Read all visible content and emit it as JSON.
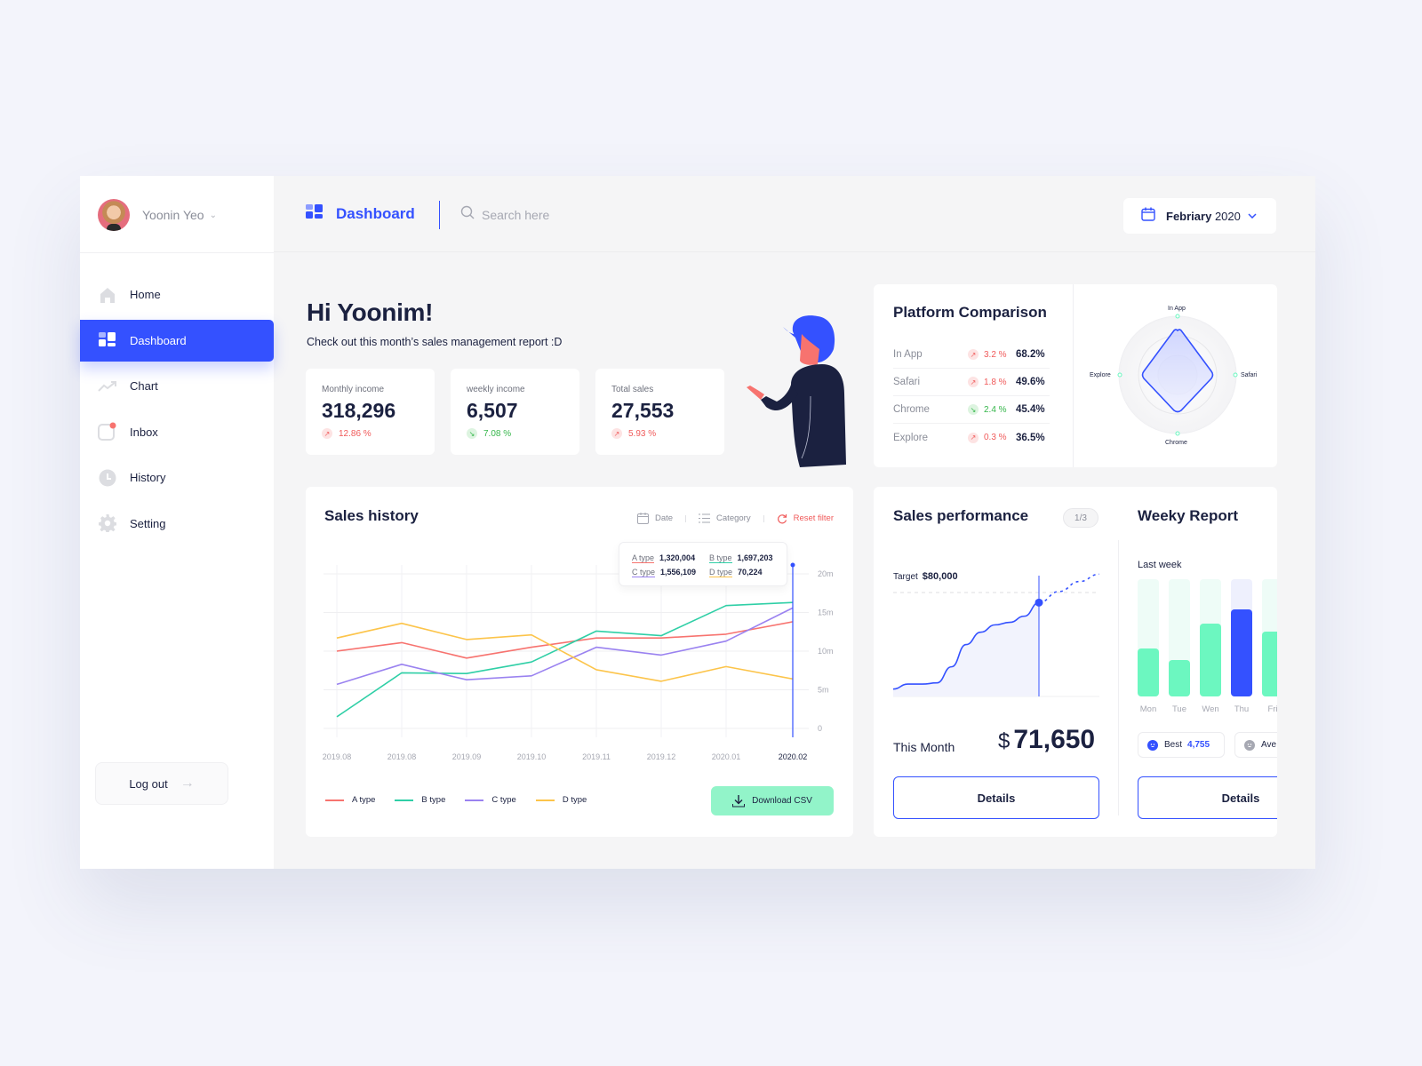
{
  "user": {
    "name": "Yoonin Yeo"
  },
  "sidebar": {
    "items": [
      {
        "label": "Home",
        "icon": "home-icon"
      },
      {
        "label": "Dashboard",
        "icon": "dashboard-icon",
        "active": true
      },
      {
        "label": "Chart",
        "icon": "trend-icon"
      },
      {
        "label": "Inbox",
        "icon": "inbox-icon"
      },
      {
        "label": "History",
        "icon": "clock-icon"
      },
      {
        "label": "Setting",
        "icon": "gear-icon"
      }
    ],
    "logout_label": "Log out"
  },
  "header": {
    "title": "Dashboard",
    "search_placeholder": "Search here",
    "date_month": "Febriary",
    "date_year": "2020"
  },
  "greeting": {
    "title": "Hi Yoonim!",
    "subtitle": "Check out this month’s sales management report :D"
  },
  "stats": [
    {
      "label": "Monthly income",
      "value": "318,296",
      "delta": "12.86 %",
      "direction": "up"
    },
    {
      "label": "weekly income",
      "value": "6,507",
      "delta": "7.08 %",
      "direction": "down"
    },
    {
      "label": "Total sales",
      "value": "27,553",
      "delta": "5.93 %",
      "direction": "up"
    }
  ],
  "platform": {
    "title": "Platform Comparison",
    "rows": [
      {
        "name": "In App",
        "delta": "3.2 %",
        "direction": "up",
        "value": "68.2%"
      },
      {
        "name": "Safari",
        "delta": "1.8 %",
        "direction": "up",
        "value": "49.6%"
      },
      {
        "name": "Chrome",
        "delta": "2.4 %",
        "direction": "down",
        "value": "45.4%"
      },
      {
        "name": "Explore",
        "delta": "0.3 %",
        "direction": "up",
        "value": "36.5%"
      }
    ],
    "radar_labels": {
      "top": "In App",
      "right": "Safari",
      "bottom": "Chrome",
      "left": "Explore"
    }
  },
  "sales_history": {
    "title": "Sales history",
    "filters": {
      "date": "Date",
      "category": "Category",
      "reset": "Reset filter"
    },
    "tooltip": [
      {
        "key": "A type",
        "value": "1,320,004",
        "color": "#f7736f"
      },
      {
        "key": "B type",
        "value": "1,697,203",
        "color": "#2fcfa6"
      },
      {
        "key": "C type",
        "value": "1,556,109",
        "color": "#9a82f0"
      },
      {
        "key": "D type",
        "value": "70,224",
        "color": "#fcc44a"
      }
    ],
    "download_label": "Download CSV"
  },
  "chart_data": [
    {
      "type": "line",
      "title": "Sales history",
      "x": [
        "2019.08",
        "2019.08",
        "2019.09",
        "2019.10",
        "2019.11",
        "2019.12",
        "2020.01",
        "2020.02"
      ],
      "yticks": [
        "0",
        "5m",
        "10m",
        "15m",
        "20m"
      ],
      "ylim": [
        0,
        20
      ],
      "yunit": "million",
      "grid": true,
      "legend": "bottom-left",
      "highlight_x": "2020.02",
      "series": [
        {
          "name": "A type",
          "color": "#f7736f",
          "values": [
            10.0,
            11.1,
            9.1,
            10.5,
            11.7,
            11.7,
            12.2,
            13.8
          ]
        },
        {
          "name": "B type",
          "color": "#2fcfa6",
          "values": [
            1.5,
            7.2,
            7.1,
            8.6,
            12.6,
            12.0,
            15.9,
            16.3
          ]
        },
        {
          "name": "C type",
          "color": "#9a82f0",
          "values": [
            5.7,
            8.3,
            6.3,
            6.8,
            10.5,
            9.5,
            11.3,
            15.6
          ]
        },
        {
          "name": "D type",
          "color": "#fcc44a",
          "values": [
            11.7,
            13.6,
            11.5,
            12.1,
            7.6,
            6.1,
            8.0,
            6.4
          ]
        }
      ]
    },
    {
      "type": "line",
      "title": "Sales performance",
      "target": 80000,
      "current": 71650,
      "progress_points": [
        0.06,
        0.1,
        0.1,
        0.11,
        0.24,
        0.42,
        0.52,
        0.58,
        0.6,
        0.65,
        0.76
      ],
      "projection_points": [
        0.76,
        0.85,
        0.93,
        0.99
      ]
    },
    {
      "type": "bar",
      "title": "Weeky Report",
      "categories": [
        "Mon",
        "Tue",
        "Wen",
        "Thu",
        "Fri"
      ],
      "values": [
        0.41,
        0.31,
        0.62,
        0.74,
        0.55
      ],
      "highlight": "Thu"
    }
  ],
  "sales_performance": {
    "title": "Sales performance",
    "page_indicator": "1/3",
    "target_label": "Target",
    "target_value": "$80,000",
    "this_month_label": "This Month",
    "currency": "$",
    "amount": "71,650",
    "details_label": "Details"
  },
  "weekly_report": {
    "title": "Weeky Report",
    "subtitle": "Last week",
    "days": [
      "Mon",
      "Tue",
      "Wen",
      "Thu",
      "Fri"
    ],
    "chips": [
      {
        "label": "Best",
        "value": "4,755"
      },
      {
        "label": "Ave",
        "value": ""
      }
    ],
    "details_label": "Details"
  },
  "colors": {
    "accent": "#3451ff",
    "dark": "#1b2140",
    "mint": "#6cf7c0",
    "up": "#f05a5a",
    "down": "#35b64a"
  }
}
